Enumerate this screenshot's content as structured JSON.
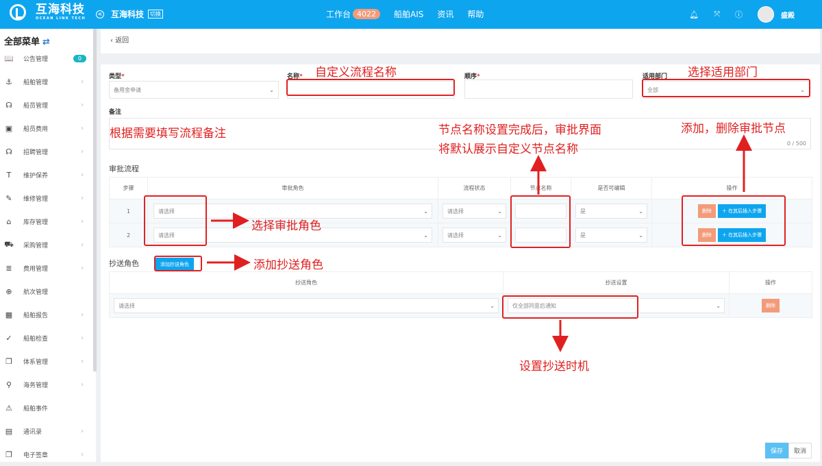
{
  "header": {
    "logo_cn": "互海科技",
    "logo_en": "OCEAN LINK TECH",
    "company": "互海科技",
    "switch_label": "切换",
    "nav": [
      {
        "label": "工作台",
        "badge": "4022"
      },
      {
        "label": "船舶AIS"
      },
      {
        "label": "资讯"
      },
      {
        "label": "帮助"
      }
    ],
    "icons": [
      "bell-icon",
      "fullscreen-icon",
      "help-icon"
    ],
    "username": "盛殿"
  },
  "sidebar": {
    "title": "全部菜单",
    "items": [
      {
        "label": "公告管理",
        "icon": "📖",
        "badge": "0"
      },
      {
        "label": "船舶管理",
        "icon": "⚓"
      },
      {
        "label": "船员管理",
        "icon": "☊"
      },
      {
        "label": "船员费用",
        "icon": "▣"
      },
      {
        "label": "招聘管理",
        "icon": "☊"
      },
      {
        "label": "维护保养",
        "icon": "T"
      },
      {
        "label": "维修管理",
        "icon": "✎"
      },
      {
        "label": "库存管理",
        "icon": "⌂"
      },
      {
        "label": "采购管理",
        "icon": "⛟"
      },
      {
        "label": "费用管理",
        "icon": "≣"
      },
      {
        "label": "航次管理",
        "icon": "⊕",
        "no_chevron": true
      },
      {
        "label": "船舶报告",
        "icon": "▦"
      },
      {
        "label": "船舶检查",
        "icon": "✓"
      },
      {
        "label": "体系管理",
        "icon": "❐"
      },
      {
        "label": "海务管理",
        "icon": "⚲"
      },
      {
        "label": "船舶事件",
        "icon": "⚠",
        "no_chevron": true
      },
      {
        "label": "通讯录",
        "icon": "▤"
      },
      {
        "label": "电子签章",
        "icon": "❐"
      }
    ]
  },
  "page": {
    "back_label": "返回",
    "form": {
      "type_label": "类型",
      "type_value": "备用金申请",
      "name_label": "名称",
      "name_value": "",
      "order_label": "顺序",
      "order_value": "",
      "dept_label": "适用部门",
      "dept_value": "全部",
      "remark_label": "备注",
      "remark_counter": "0 / 500"
    },
    "approval": {
      "title": "审批流程",
      "columns": [
        "步骤",
        "审批角色",
        "流程状态",
        "节点名称",
        "是否可编辑",
        "操作"
      ],
      "rows": [
        {
          "step": "1",
          "role": "请选择",
          "status": "请选择",
          "node_name": "",
          "editable": "是"
        },
        {
          "step": "2",
          "role": "请选择",
          "status": "请选择",
          "node_name": "",
          "editable": "是"
        }
      ],
      "delete_label": "删除",
      "insert_label": "在其后插入步骤"
    },
    "cc": {
      "title": "抄送角色",
      "add_label": "添加抄送角色",
      "columns": [
        "抄送角色",
        "抄送设置",
        "操作"
      ],
      "rows": [
        {
          "role": "请选择",
          "setting": "仅全部同意后通知"
        }
      ],
      "delete_label": "删除"
    },
    "footer": {
      "save": "保存",
      "cancel": "取消"
    }
  },
  "annotations": {
    "name": "自定义流程名称",
    "dept": "选择适用部门",
    "remark": "根据需要填写流程备注",
    "node_line1": "节点名称设置完成后，审批界面",
    "node_line2": "将默认展示自定义节点名称",
    "ops": "添加，删除审批节点",
    "role": "选择审批角色",
    "cc_add": "添加抄送角色",
    "cc_timing": "设置抄送时机"
  },
  "colors": {
    "primary": "#0ea5ef",
    "danger_button": "#f39b7a",
    "annotation": "#e02020",
    "badge_teal": "#1ab5c4"
  }
}
